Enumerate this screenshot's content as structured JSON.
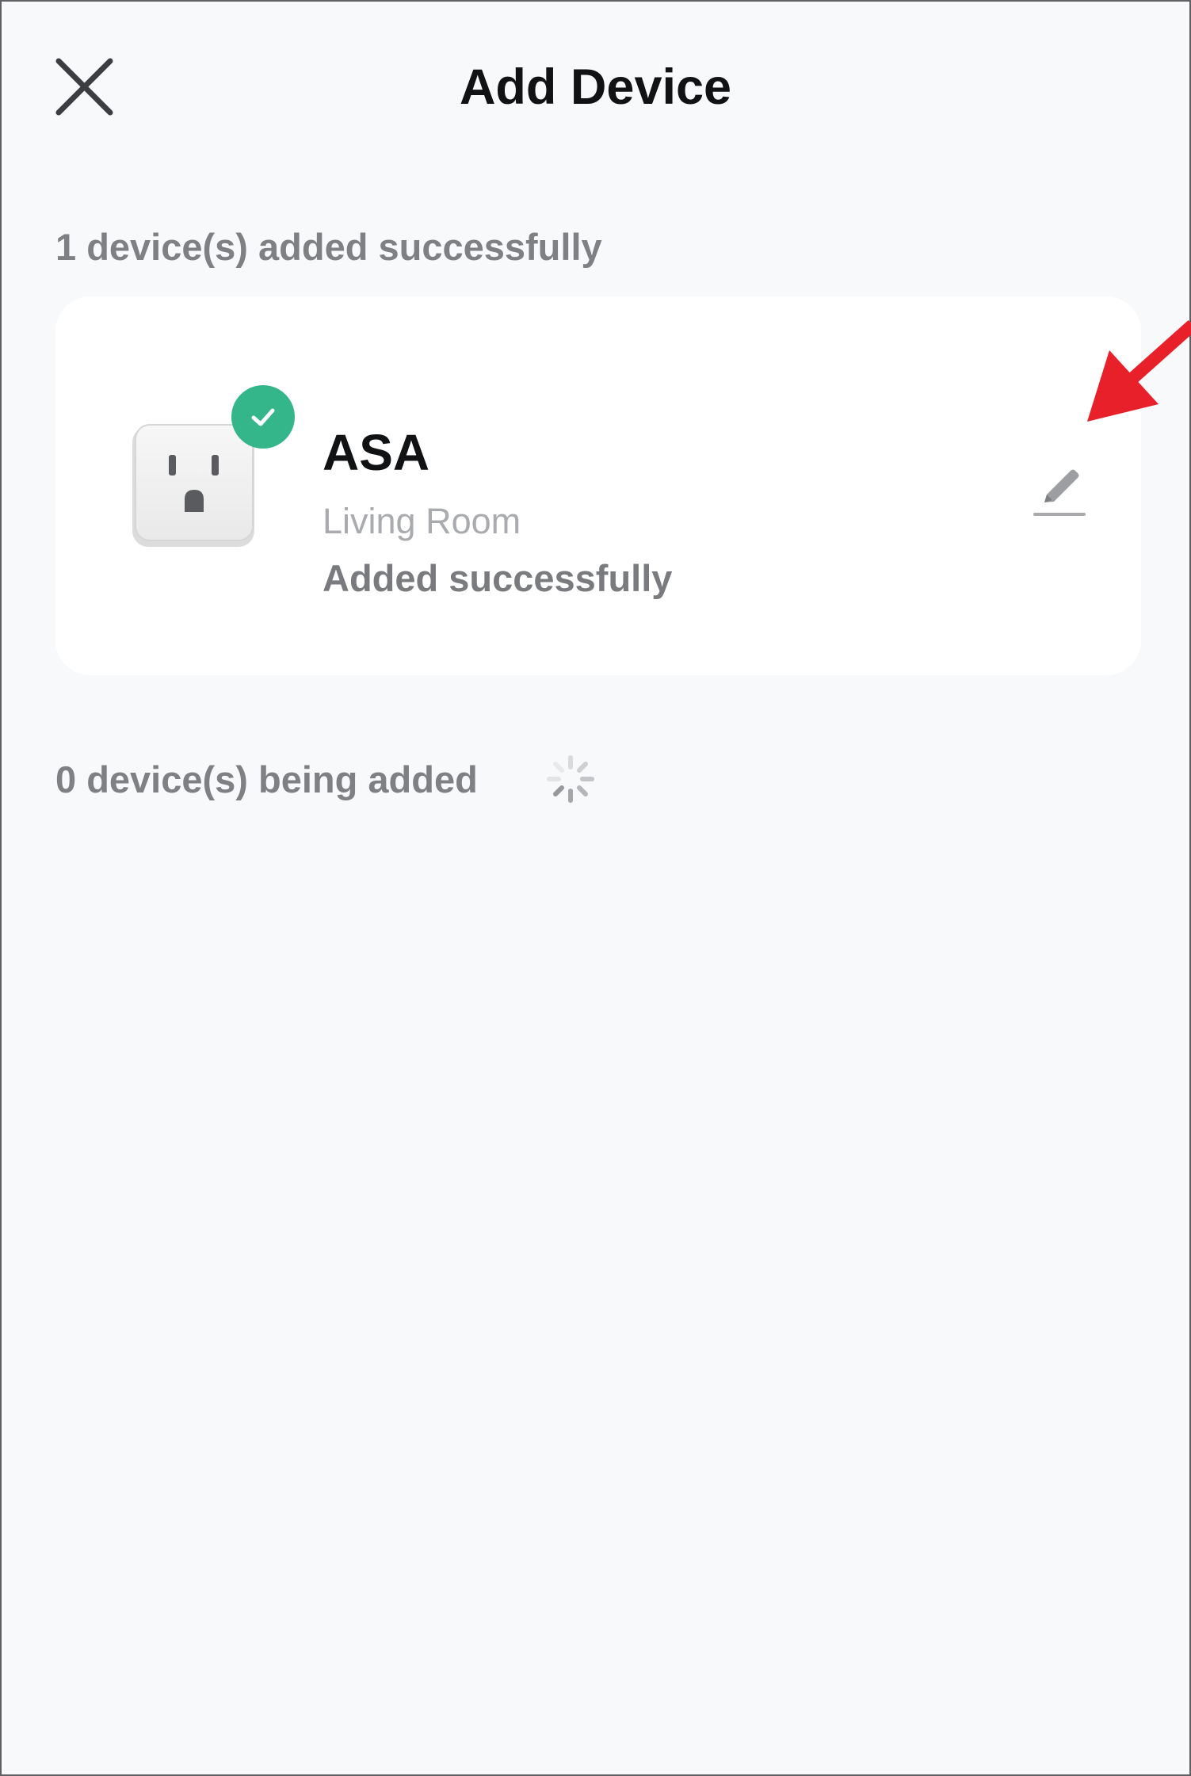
{
  "header": {
    "title": "Add Device",
    "close_icon": "close-icon"
  },
  "added_section": {
    "label": "1 device(s) added successfully"
  },
  "device": {
    "name": "ASA",
    "room": "Living Room",
    "status": "Added successfully",
    "image_icon": "smart-plug-icon",
    "badge_icon": "check-icon",
    "edit_icon": "pencil-icon"
  },
  "adding_section": {
    "label": "0 device(s) being added",
    "spinner_icon": "loading-spinner-icon"
  },
  "annotation": {
    "icon": "red-arrow-icon",
    "color": "#e8202a"
  },
  "colors": {
    "background": "#f8f9fb",
    "card": "#ffffff",
    "success_badge": "#34b58a",
    "title_text": "#111214",
    "secondary_text": "#7f8083"
  }
}
